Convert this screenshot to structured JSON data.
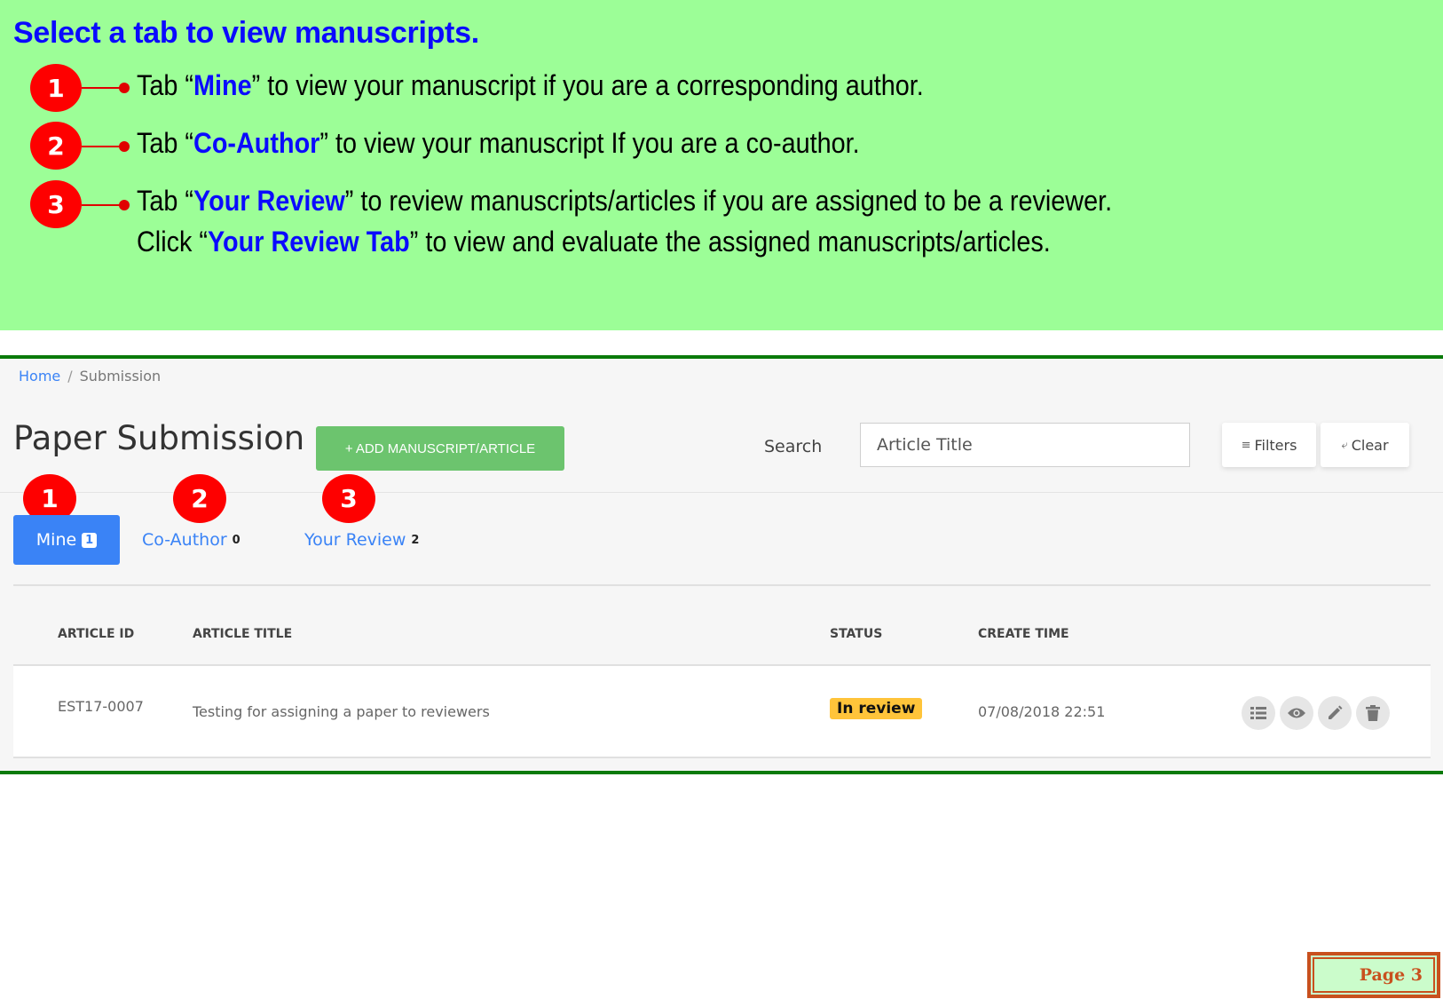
{
  "instructions": {
    "title": "Select a tab to view manuscripts.",
    "steps": [
      {
        "number": "1",
        "pre": "Tab “",
        "highlight": "Mine",
        "post": "” to view your manuscript if you are a corresponding author."
      },
      {
        "number": "2",
        "pre": "Tab “",
        "highlight": "Co-Author",
        "post": "” to view your manuscript If you are a co-author."
      },
      {
        "number": "3",
        "pre": "Tab “",
        "highlight": "Your Review",
        "post": "” to review manuscripts/articles if you are assigned to be a reviewer."
      }
    ],
    "extra": {
      "pre": "Click “",
      "highlight": "Your Review Tab",
      "post": "” to view and evaluate the assigned manuscripts/articles."
    },
    "colors": {
      "background": "#9cfe97",
      "highlight": "#0a0afe",
      "badge": "#fe0000"
    }
  },
  "app": {
    "breadcrumb": {
      "home": "Home",
      "separator": "/",
      "current": "Submission"
    },
    "page_title": "Paper Submission",
    "add_button": "+ ADD MANUSCRIPT/ARTICLE",
    "search": {
      "label": "Search",
      "placeholder": "Article Title"
    },
    "filters_button": "Filters",
    "clear_button": "Clear",
    "tab_markers": [
      "1",
      "2",
      "3"
    ],
    "tabs": [
      {
        "label": "Mine",
        "count": "1",
        "active": true
      },
      {
        "label": "Co-Author",
        "count": "0",
        "active": false
      },
      {
        "label": "Your Review",
        "count": "2",
        "active": false
      }
    ],
    "table": {
      "headers": {
        "id": "ARTICLE ID",
        "title": "ARTICLE TITLE",
        "status": "STATUS",
        "created": "CREATE TIME"
      },
      "rows": [
        {
          "id": "EST17-0007",
          "title": "Testing for assigning a paper to reviewers",
          "status": "In review",
          "created": "07/08/2018 22:51"
        }
      ],
      "actions": [
        "list-icon",
        "eye-icon",
        "pencil-icon",
        "trash-icon"
      ]
    },
    "colors": {
      "primary": "#3a83f6",
      "success": "#6cc46e",
      "warning": "#ffc43a",
      "frame_border": "#0a7a0a"
    }
  },
  "page_tag": "Page 3"
}
